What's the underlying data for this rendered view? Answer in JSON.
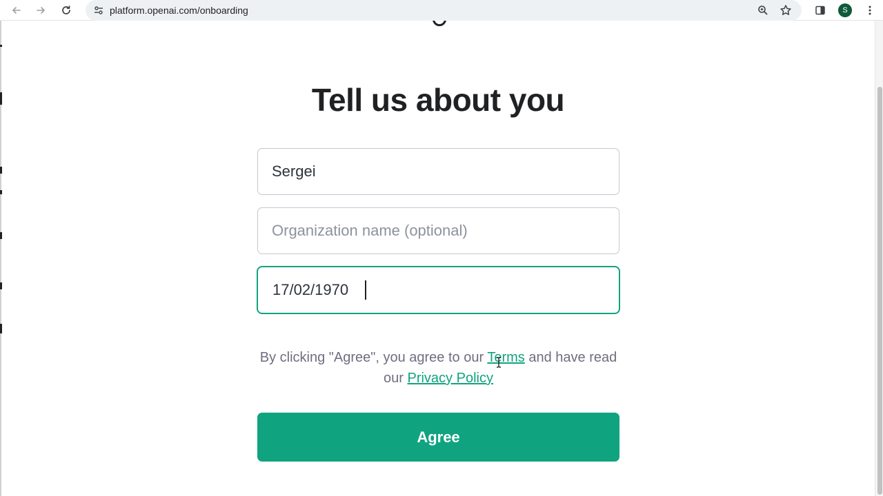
{
  "browser": {
    "url": "platform.openai.com/onboarding",
    "avatar_letter": "S",
    "icons": [
      "back-icon",
      "forward-icon",
      "reload-icon",
      "site-info-icon",
      "zoom-icon",
      "bookmark-star-icon",
      "side-panel-icon",
      "menu-dots-icon"
    ]
  },
  "page": {
    "heading": "Tell us about you",
    "fields": {
      "name": {
        "value": "Sergei",
        "placeholder": ""
      },
      "organization": {
        "value": "",
        "placeholder": "Organization name (optional)"
      },
      "birthday": {
        "value": "17/02/1970",
        "placeholder": ""
      }
    },
    "terms": {
      "prefix": "By clicking \"Agree\", you agree to our ",
      "terms_link": "Terms",
      "middle": " and have read our ",
      "privacy_link": "Privacy Policy"
    },
    "agree_label": "Agree"
  },
  "colors": {
    "accent": "#10a37f",
    "heading": "#202123",
    "muted_text": "#6e6e80",
    "avatar": "#0f5a3a"
  }
}
